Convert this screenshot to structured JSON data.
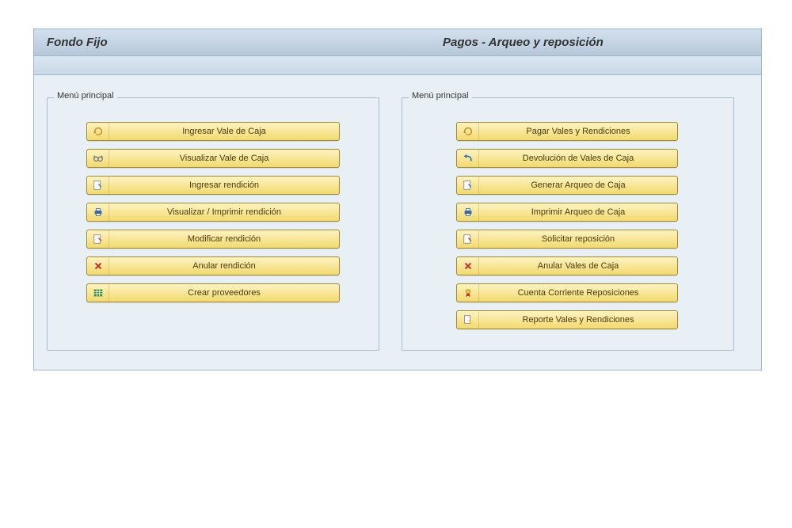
{
  "header": {
    "left_title": "Fondo Fijo",
    "right_title": "Pagos - Arqueo y reposición"
  },
  "panels": {
    "left": {
      "title": "Menú principal",
      "items": [
        {
          "label": "Ingresar Vale de Caja",
          "icon": "refresh-icon"
        },
        {
          "label": "Visualizar Vale de Caja",
          "icon": "glasses-icon"
        },
        {
          "label": "Ingresar rendición",
          "icon": "pencil-icon"
        },
        {
          "label": "Visualizar / Imprimir rendición",
          "icon": "printer-icon"
        },
        {
          "label": "Modificar rendición",
          "icon": "redpencil-icon"
        },
        {
          "label": "Anular rendición",
          "icon": "x-icon"
        },
        {
          "label": "Crear proveedores",
          "icon": "grid-icon"
        }
      ]
    },
    "right": {
      "title": "Menú principal",
      "items": [
        {
          "label": "Pagar Vales y Rendiciones",
          "icon": "refresh-icon"
        },
        {
          "label": "Devolución de Vales de Caja",
          "icon": "undo-icon"
        },
        {
          "label": "Generar Arqueo de Caja",
          "icon": "bluepencil-icon"
        },
        {
          "label": "Imprimir Arqueo de Caja",
          "icon": "printer-icon"
        },
        {
          "label": "Solicitar reposición",
          "icon": "redpencil-icon"
        },
        {
          "label": "Anular Vales de Caja",
          "icon": "x-icon"
        },
        {
          "label": "Cuenta Corriente Reposiciones",
          "icon": "medal-icon"
        },
        {
          "label": "Reporte Vales y Rendiciones",
          "icon": "doc-icon"
        }
      ]
    }
  }
}
